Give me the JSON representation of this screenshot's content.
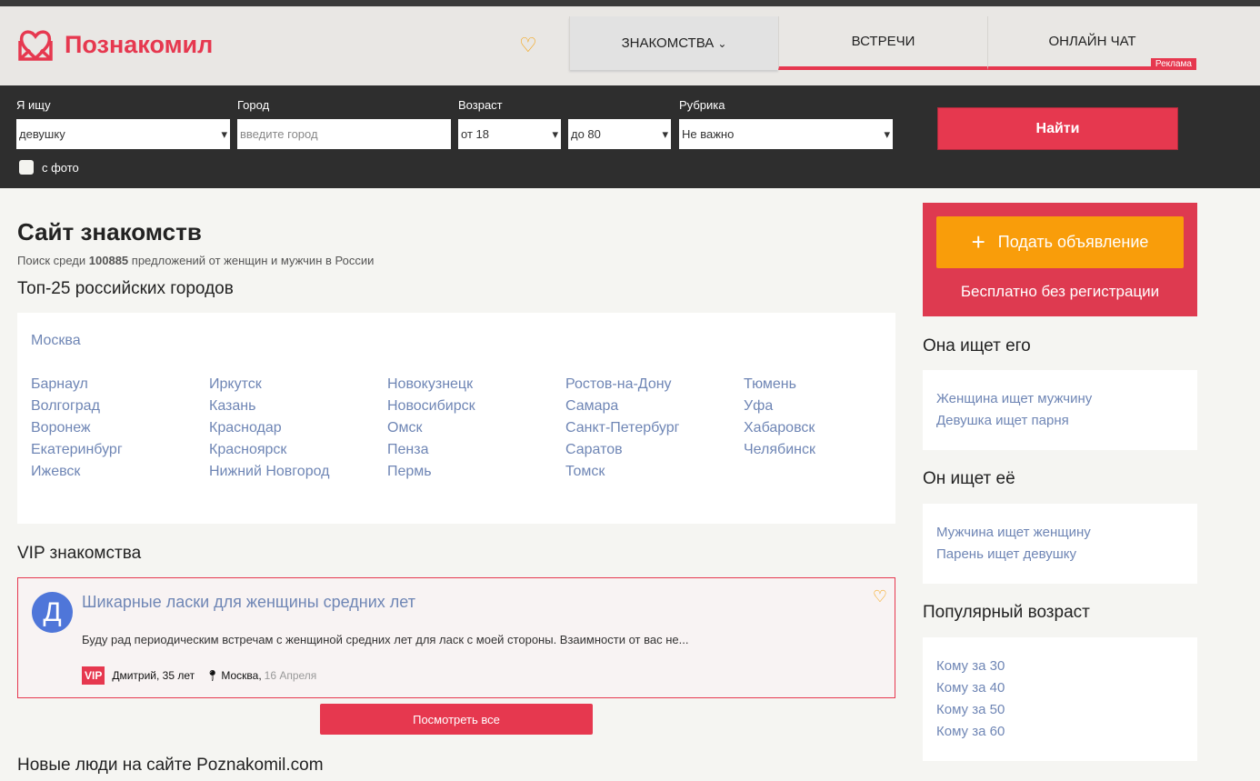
{
  "header": {
    "logo": "Познакомил",
    "nav": [
      {
        "label": "ЗНАКОМСТВА"
      },
      {
        "label": "ВСТРЕЧИ"
      },
      {
        "label": "ОНЛАЙН ЧАТ",
        "badge": "Реклама"
      }
    ]
  },
  "search": {
    "seeking_label": "Я ищу",
    "seeking_value": "девушку",
    "city_label": "Город",
    "city_placeholder": "введите город",
    "age_label": "Возраст",
    "age_from": "от 18",
    "age_to": "до 80",
    "rubric_label": "Рубрика",
    "rubric_value": "Не важно",
    "photo_label": "с фото",
    "find_button": "Найти"
  },
  "main": {
    "title": "Сайт знакомств",
    "subtitle_pre": "Поиск среди ",
    "subtitle_count": "100885",
    "subtitle_post": " предложений от женщин и мужчин в России",
    "top_cities_title": "Топ-25 российских городов",
    "capital": "Москва",
    "city_columns": [
      [
        "Барнаул",
        "Волгоград",
        "Воронеж",
        "Екатеринбург",
        "Ижевск"
      ],
      [
        "Иркутск",
        "Казань",
        "Краснодар",
        "Красноярск",
        "Нижний Новгород"
      ],
      [
        "Новокузнецк",
        "Новосибирск",
        "Омск",
        "Пенза",
        "Пермь"
      ],
      [
        "Ростов-на-Дону",
        "Самара",
        "Санкт-Петербург",
        "Саратов",
        "Томск"
      ],
      [
        "Тюмень",
        "Уфа",
        "Хабаровск",
        "Челябинск"
      ]
    ],
    "vip_title": "VIP знакомства",
    "vip_ad": {
      "avatar_letter": "Д",
      "title": "Шикарные ласки для женщины средних лет",
      "text": "Буду рад периодическим встречам с женщиной средних лет для ласк с моей стороны. Взаимности от вас не...",
      "badge": "VIP",
      "author": "Дмитрий, 35 лет",
      "city": "Москва,",
      "date": "16 Апреля"
    },
    "view_all": "Посмотреть все",
    "new_people_title": "Новые люди на сайте Poznakomil.com"
  },
  "sidebar": {
    "post_button": "Подать объявление",
    "free_text": "Бесплатно без регистрации",
    "sections": [
      {
        "title": "Она ищет его",
        "links": [
          "Женщина ищет мужчину",
          "Девушка ищет парня"
        ]
      },
      {
        "title": "Он ищет её",
        "links": [
          "Мужчина ищет женщину",
          "Парень ищет девушку"
        ]
      },
      {
        "title": "Популярный возраст",
        "links": [
          "Кому за 30",
          "Кому за 40",
          "Кому за 50",
          "Кому за 60"
        ]
      }
    ]
  }
}
